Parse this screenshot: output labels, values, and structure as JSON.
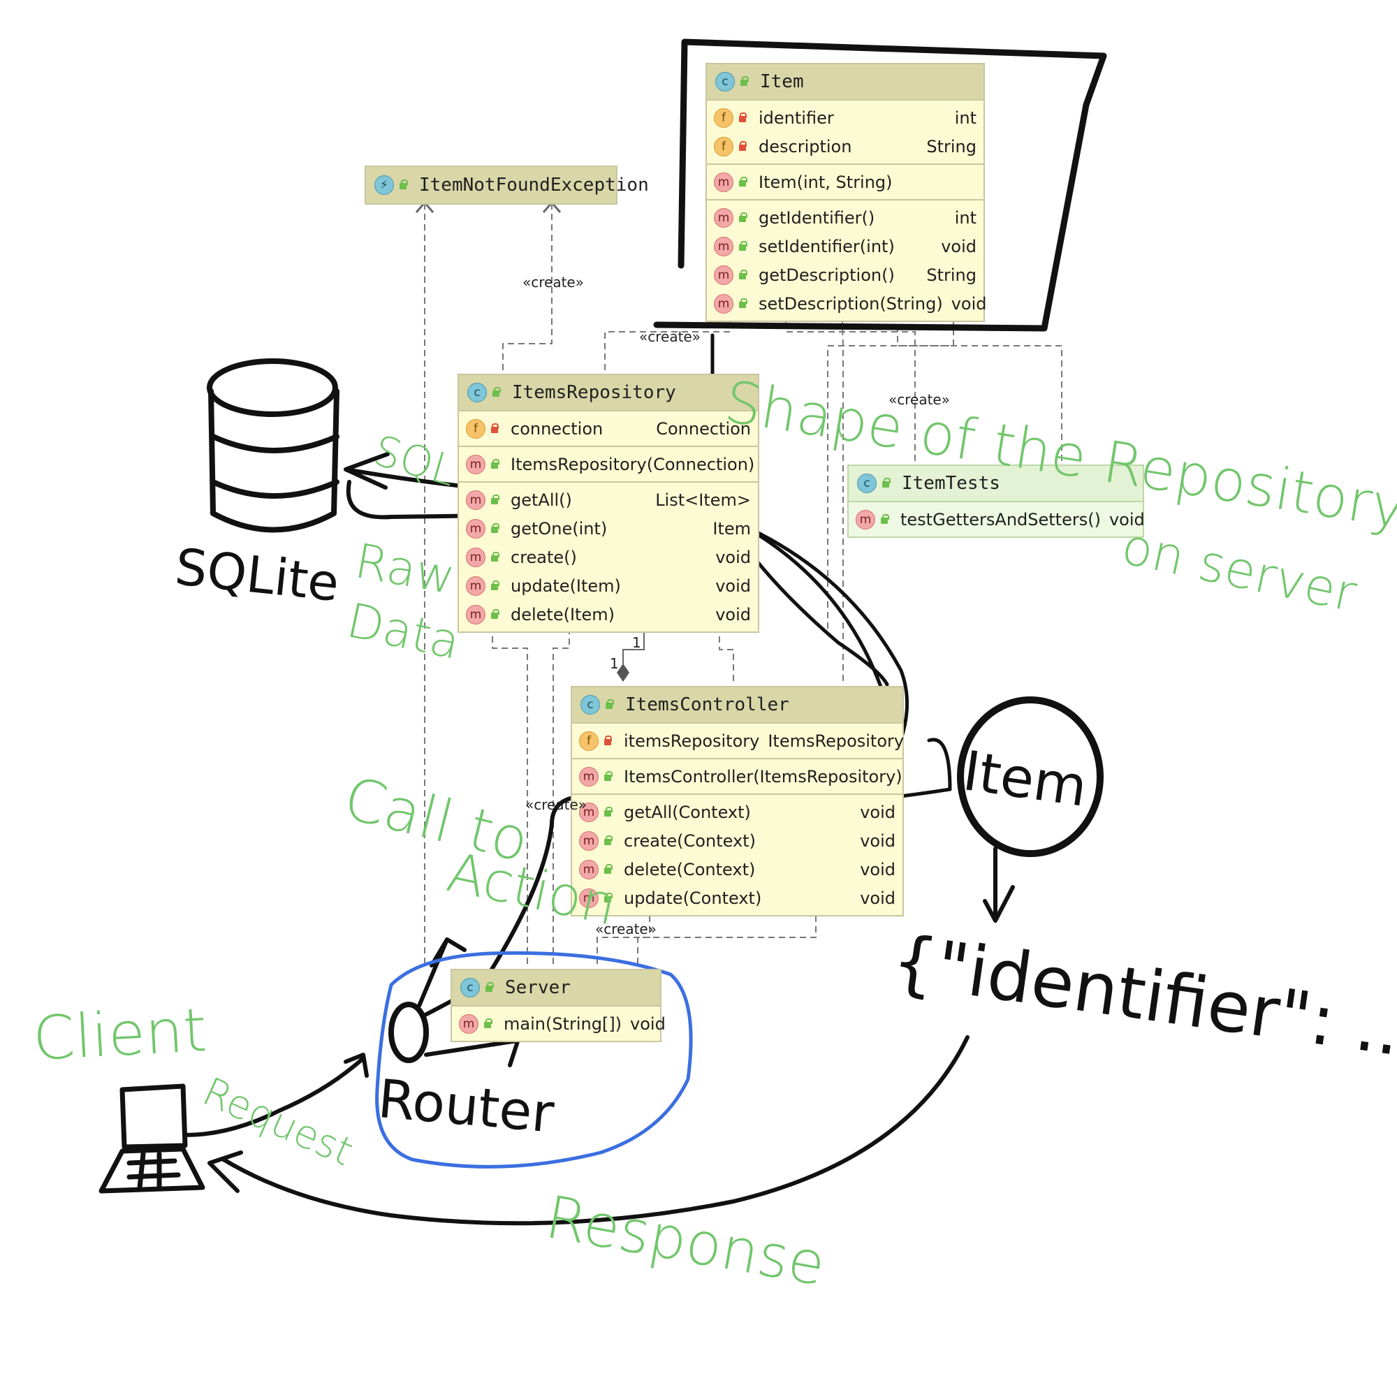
{
  "classes": {
    "item": {
      "name": "Item",
      "fields": [
        {
          "name": "identifier",
          "type": "int"
        },
        {
          "name": "description",
          "type": "String"
        }
      ],
      "constructors": [
        {
          "name": "Item(int, String)",
          "type": ""
        }
      ],
      "methods": [
        {
          "name": "getIdentifier()",
          "type": "int"
        },
        {
          "name": "setIdentifier(int)",
          "type": "void"
        },
        {
          "name": "getDescription()",
          "type": "String"
        },
        {
          "name": "setDescription(String)",
          "type": "void"
        }
      ]
    },
    "exception": {
      "name": "ItemNotFoundException"
    },
    "repository": {
      "name": "ItemsRepository",
      "fields": [
        {
          "name": "connection",
          "type": "Connection"
        }
      ],
      "constructors": [
        {
          "name": "ItemsRepository(Connection)",
          "type": ""
        }
      ],
      "methods": [
        {
          "name": "getAll()",
          "type": "List<Item>"
        },
        {
          "name": "getOne(int)",
          "type": "Item"
        },
        {
          "name": "create()",
          "type": "void"
        },
        {
          "name": "update(Item)",
          "type": "void"
        },
        {
          "name": "delete(Item)",
          "type": "void"
        }
      ]
    },
    "tests": {
      "name": "ItemTests",
      "methods": [
        {
          "name": "testGettersAndSetters()",
          "type": "void"
        }
      ]
    },
    "controller": {
      "name": "ItemsController",
      "fields": [
        {
          "name": "itemsRepository",
          "type": "ItemsRepository"
        }
      ],
      "constructors": [
        {
          "name": "ItemsController(ItemsRepository)",
          "type": ""
        }
      ],
      "methods": [
        {
          "name": "getAll(Context)",
          "type": "void"
        },
        {
          "name": "create(Context)",
          "type": "void"
        },
        {
          "name": "delete(Context)",
          "type": "void"
        },
        {
          "name": "update(Context)",
          "type": "void"
        }
      ]
    },
    "server": {
      "name": "Server",
      "methods": [
        {
          "name": "main(String[])",
          "type": "void"
        }
      ]
    }
  },
  "relation_labels": {
    "create": "«create»",
    "mult_one_top": "1",
    "mult_one_bottom": "1"
  },
  "annotations": {
    "shape_note": "Shape of the Repository",
    "shape_note_2": "on server",
    "sql": "SQL",
    "raw_data": "Raw",
    "raw_data_2": "Data",
    "sqlite": "SQLite",
    "call_to": "Call to",
    "action": "Action",
    "client": "Client",
    "request": "Request",
    "router": "Router",
    "item_bubble": "Item",
    "json_snippet": "{\"identifier\": ...}",
    "response": "Response"
  },
  "colors": {
    "class_fill": "#fdfbd3",
    "class_header": "#d9d6a8",
    "annotation_green": "#72c66c",
    "router_circle_blue": "#3b6fe0",
    "ink": "#111111"
  }
}
